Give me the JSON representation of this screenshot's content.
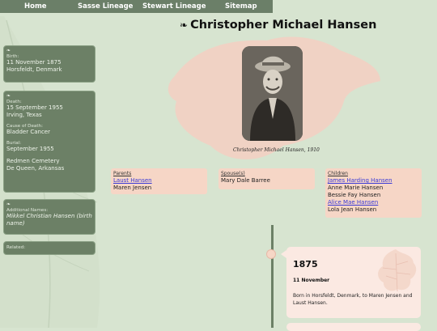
{
  "nav": {
    "items": [
      "Home",
      "Sasse Lineage",
      "Stewart Lineage",
      "Sitemap"
    ]
  },
  "title": {
    "ornament": "❧",
    "text": "Christopher Michael Hansen"
  },
  "photo": {
    "caption": "Christopher Michael Hansen, 1910"
  },
  "sidebar": {
    "birth": {
      "ornament": "❧",
      "label": "Birth:",
      "date": "11 November 1875",
      "place": "Horsfeldt, Denmark"
    },
    "death": {
      "ornament": "❧",
      "label": "Death:",
      "date": "15 September 1955",
      "place": "Irving, Texas",
      "cause_label": "Cause of Death:",
      "cause": "Bladder Cancer",
      "burial_label": "Burial:",
      "burial_date": "September 1955",
      "cemetery": "Redmen Cemetery",
      "cemetery_place": "De Queen, Arkansas"
    },
    "names": {
      "ornament": "❧",
      "label": "Additional Names:",
      "name": "Mikkel Christian Hansen (birth name)"
    },
    "related": {
      "label": "Related:"
    }
  },
  "family": {
    "parents": {
      "heading": "Parents",
      "items": [
        "Laust Hansen",
        "Maren Jensen"
      ]
    },
    "spouses": {
      "heading": "Spouse(s)",
      "items": [
        "Mary Dale Barree"
      ]
    },
    "children": {
      "heading": "Children",
      "items": [
        "James Harding Hansen",
        "Anne Marie Hansen",
        "Bessie Fay Hansen",
        "Alice Mae Hansen",
        "Lola Jean Hansen"
      ]
    }
  },
  "timeline": {
    "year": "1875",
    "date": "11 November",
    "description": "Born in Horsfeldt, Denmark, to Maren Jensen and Laust Hansen."
  },
  "colors": {
    "background": "#d7e4d0",
    "sidebar": "#6c8066",
    "panel": "#f6d6c6",
    "link": "#3a3ad6"
  }
}
